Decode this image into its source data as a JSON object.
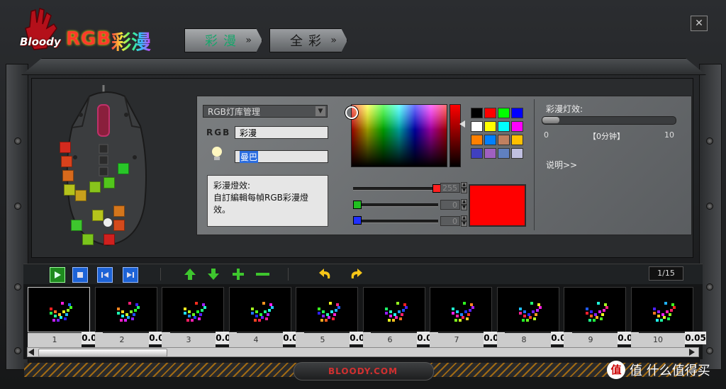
{
  "app": {
    "brand": "Bloody",
    "title_rgb": "RGB",
    "title_cjk": "彩漫",
    "close_label": "✕"
  },
  "tabs": [
    {
      "label": "彩漫",
      "active": true
    },
    {
      "label": "全彩",
      "active": false
    }
  ],
  "library": {
    "dropdown_value": "RGB灯库管理",
    "rgb_label": "RGB",
    "rgb_name": "彩漫",
    "preset_name": "曼巴"
  },
  "description": {
    "title": "彩漫燈效:",
    "text": "自訂編輯每幀RGB彩漫燈效。"
  },
  "palette": {
    "colors": [
      "#000000",
      "#ff0000",
      "#00ff00",
      "#0000ff",
      "#ffffff",
      "#ffff00",
      "#00ffff",
      "#ff00ff",
      "#ff8000",
      "#0080ff",
      "#c08060",
      "#ffc000",
      "#4040c0",
      "#a060c0",
      "#6080c0",
      "#c0c0e0"
    ]
  },
  "sliders": {
    "red": {
      "value": "255",
      "color": "#ff2020"
    },
    "green": {
      "value": "0",
      "color": "#20c020"
    },
    "blue": {
      "value": "0",
      "color": "#2030ff"
    }
  },
  "preview_color": "#ff0000",
  "effect": {
    "label": "彩漫灯效:",
    "min_label": "0",
    "max_label": "10",
    "current_label": "【0分钟】",
    "level": 0,
    "explain_label": "说明>>"
  },
  "toolbar": {
    "page_indicator": "1/15"
  },
  "frames": [
    {
      "num": "1",
      "delay": "0.05"
    },
    {
      "num": "2",
      "delay": "0.05"
    },
    {
      "num": "3",
      "delay": "0.05"
    },
    {
      "num": "4",
      "delay": "0.05"
    },
    {
      "num": "5",
      "delay": "0.05"
    },
    {
      "num": "6",
      "delay": "0.05"
    },
    {
      "num": "7",
      "delay": "0.05"
    },
    {
      "num": "8",
      "delay": "0.05"
    },
    {
      "num": "9",
      "delay": "0.05"
    },
    {
      "num": "10",
      "delay": "0.05"
    }
  ],
  "footer": {
    "site": "BLOODY.COM",
    "watermark": "值 什么值得买"
  }
}
